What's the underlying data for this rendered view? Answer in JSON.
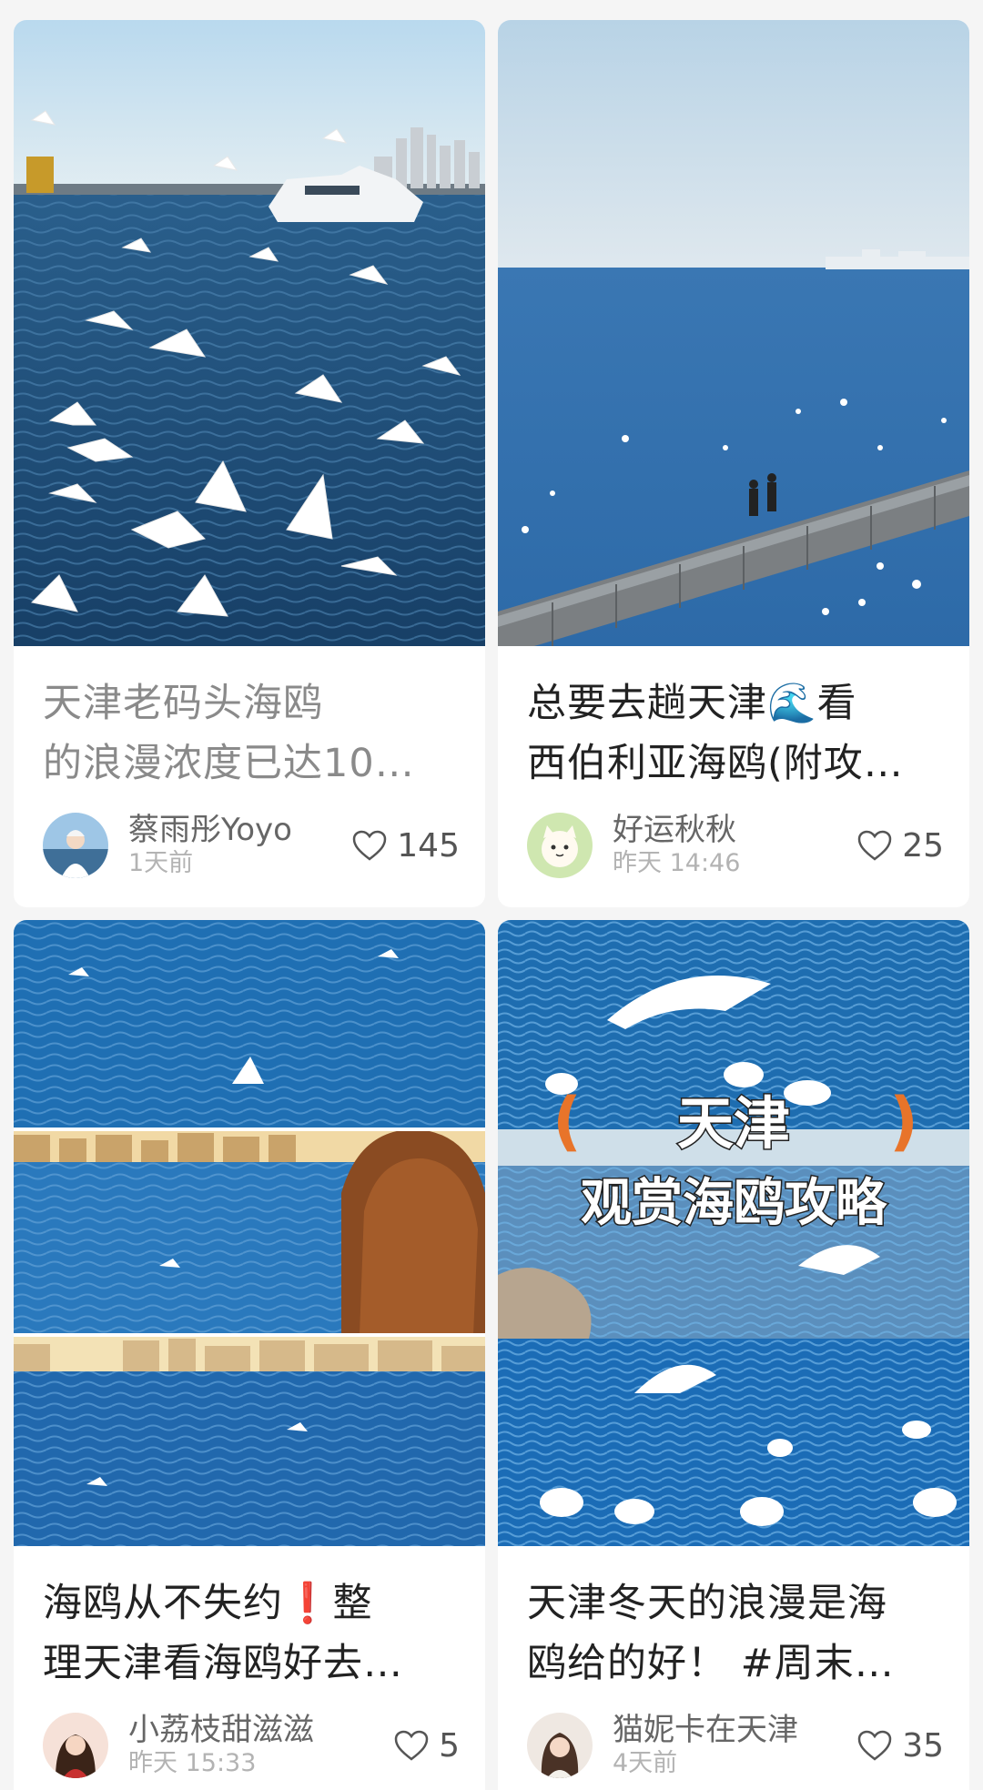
{
  "cards": [
    {
      "title_line1": "天津老码头海鸥",
      "title_line2": "的浪漫浓度已达10…",
      "author": "蔡雨彤Yoyo",
      "time": "1天前",
      "likes": "145"
    },
    {
      "title_line1": "总要去趟天津🌊看",
      "title_line2": "西伯利亚海鸥(附攻…",
      "author": "好运秋秋",
      "time": "昨天 14:46",
      "likes": "25"
    },
    {
      "title_line1_a": "海鸥从不失约",
      "title_line1_mark": "❗",
      "title_line1_b": "整",
      "title_line2": "理天津看海鸥好去…",
      "author": "小荔枝甜滋滋",
      "time": "昨天 15:33",
      "likes": "5"
    },
    {
      "title_line1": "天津冬天的浪漫是海",
      "title_line2": "鸥给的好！ #周末…",
      "author": "猫妮卡在天津",
      "time": "4天前",
      "likes": "35",
      "cover_text_1": "天津",
      "cover_text_2": "观赏海鸥攻略",
      "bracket_left": "(",
      "bracket_right": ")"
    }
  ],
  "icons": {
    "like": "heart-outline-icon"
  },
  "colors": {
    "sea": "#1f5e9c",
    "sky": "#cfe3f0",
    "accent_orange": "#e8742a"
  }
}
